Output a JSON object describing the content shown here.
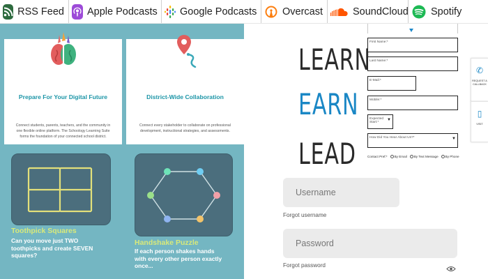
{
  "podcast_bar": {
    "items": [
      {
        "label": "RSS Feed",
        "icon": "rss-icon",
        "color": "#2e6b3f"
      },
      {
        "label": "Apple Podcasts",
        "icon": "apple-podcasts-icon",
        "color": "#9d4bd8"
      },
      {
        "label": "Google Podcasts",
        "icon": "google-podcasts-icon",
        "color": "#ea4335"
      },
      {
        "label": "Overcast",
        "icon": "overcast-icon",
        "color": "#fc7e0f"
      },
      {
        "label": "SoundCloud",
        "icon": "soundcloud-icon",
        "color": "#ff5500"
      },
      {
        "label": "Spotify",
        "icon": "spotify-icon",
        "color": "#1db954"
      }
    ]
  },
  "cards": [
    {
      "title": "Prepare For Your Digital Future",
      "text": "Connect students, parents, teachers, and the community in one flexible online platform. The Schoology Learning Suite forms the foundation of your connected school district.",
      "icon": "brain-icon"
    },
    {
      "title": "District-Wide Collaboration",
      "text": "Connect every stakeholder to collaborate on professional development, instructional strategies, and assessments.",
      "icon": "location-path-icon"
    }
  ],
  "puzzles": [
    {
      "title": "Toothpick Squares",
      "text": "Can you move just TWO toothpicks and create SEVEN squares?"
    },
    {
      "title": "Handshake Puzzle",
      "text": "If each person shakes hands with every other person exactly once..."
    }
  ],
  "slogan": [
    "LEARN",
    "EARN",
    "LEAD"
  ],
  "form": {
    "first_name": "First Name:*",
    "last_name": "Last Name:*",
    "email": "E-Mail:*",
    "mobile": "Mobile:*",
    "expected_start": "Expected Start:*",
    "heard_about": "How Did You Hear About Us?*",
    "contact_label": "Contact Pref:*",
    "contact_options": [
      "By Email",
      "By Text Message",
      "By Phone"
    ]
  },
  "side_tabs": [
    {
      "label": "REQUEST A CALLBACK",
      "icon": "phone-icon"
    },
    {
      "label": "VISIT",
      "icon": "mobile-icon"
    }
  ],
  "login": {
    "username_placeholder": "Username",
    "password_placeholder": "Password",
    "forgot_username": "Forgot username",
    "forgot_password": "Forgot password"
  },
  "colors": {
    "panel_bg": "#74b6c2",
    "accent_blue": "#1a87c5",
    "card_title": "#1c95a7",
    "puzzle_title": "#d8e97a"
  }
}
